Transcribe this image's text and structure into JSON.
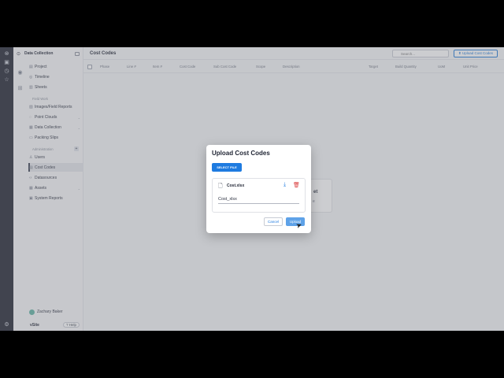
{
  "rail": {
    "icons": [
      "dashboard-icon",
      "folder-icon",
      "clock-icon",
      "star-icon",
      "grid-icon",
      "settings-icon"
    ]
  },
  "sidebar": {
    "project_title": "Data Collection",
    "items_top": [
      {
        "label": "Project",
        "icon": "project-icon"
      },
      {
        "label": "Timeline",
        "icon": "timeline-icon"
      },
      {
        "label": "Sheets",
        "icon": "sheets-icon"
      }
    ],
    "section_field": "Field Work",
    "items_field": [
      {
        "label": "Images/Field Reports",
        "icon": "images-icon",
        "chevron": false
      },
      {
        "label": "Point Clouds",
        "icon": "cloud-icon",
        "chevron": true
      },
      {
        "label": "Data Collection",
        "icon": "data-icon",
        "chevron": true
      },
      {
        "label": "Packing Slips",
        "icon": "slip-icon",
        "chevron": false
      }
    ],
    "section_admin": "Administration",
    "items_admin": [
      {
        "label": "Users",
        "icon": "users-icon",
        "chevron": false
      },
      {
        "label": "Cost Codes",
        "icon": "cost-icon",
        "chevron": false
      },
      {
        "label": "Datasources",
        "icon": "code-icon",
        "chevron": false
      },
      {
        "label": "Assets",
        "icon": "assets-icon",
        "chevron": true
      },
      {
        "label": "System Reports",
        "icon": "report-icon",
        "chevron": false
      }
    ],
    "user_name": "Zachary Baker",
    "logo": "vSite",
    "help": "Help"
  },
  "main": {
    "title": "Cost Codes",
    "search_placeholder": "Search...",
    "upload_button": "Upload Cost Codes",
    "columns": [
      "Phase",
      "Line #",
      "Item #",
      "Cost Code",
      "Sub Cost Code",
      "Scope",
      "Description",
      "Target",
      "Build Quantity",
      "UoM",
      "Unit Price"
    ],
    "empty_text": "et",
    "empty_text2": "e"
  },
  "modal": {
    "title": "Upload Cost Codes",
    "select_file": "SELECT FILE",
    "file_name": "Cost.xlsx",
    "name_value": "Cost_xlsx",
    "cancel": "Cancel",
    "upload": "Upload"
  }
}
